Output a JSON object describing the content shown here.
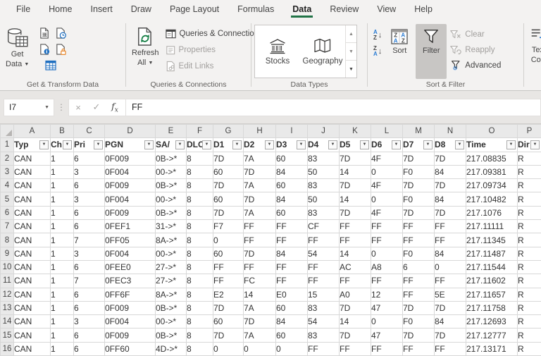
{
  "ribbon": {
    "tabs": [
      "File",
      "Home",
      "Insert",
      "Draw",
      "Page Layout",
      "Formulas",
      "Data",
      "Review",
      "View",
      "Help"
    ],
    "active_tab": "Data",
    "accent_green": "#217346",
    "groups": {
      "get_transform": {
        "label": "Get & Transform Data",
        "get_data_line1": "Get",
        "get_data_line2": "Data"
      },
      "queries": {
        "label": "Queries & Connections",
        "refresh_line1": "Refresh",
        "refresh_line2": "All",
        "items": [
          {
            "label": "Queries & Connections",
            "enabled": true
          },
          {
            "label": "Properties",
            "enabled": false
          },
          {
            "label": "Edit Links",
            "enabled": false
          }
        ]
      },
      "data_types": {
        "label": "Data Types",
        "items": [
          "Stocks",
          "Geography"
        ]
      },
      "sort_filter": {
        "label": "Sort & Filter",
        "sort": "Sort",
        "filter": "Filter",
        "clear": "Clear",
        "reapply": "Reapply",
        "advanced": "Advanced"
      },
      "text_columns": {
        "label_line1": "Text",
        "label_line2": "Colu"
      }
    }
  },
  "formula_bar": {
    "name_box": "I7",
    "formula": "FF"
  },
  "grid": {
    "column_letters": [
      "A",
      "B",
      "C",
      "D",
      "E",
      "F",
      "G",
      "H",
      "I",
      "J",
      "K",
      "L",
      "M",
      "N",
      "O",
      "P"
    ],
    "headers": [
      "Typ",
      "Ch",
      "Pri",
      "PGN",
      "SA/",
      "DLC",
      "D1",
      "D2",
      "D3",
      "D4",
      "D5",
      "D6",
      "D7",
      "D8",
      "Time",
      "Dir"
    ],
    "rows": [
      [
        "CAN",
        "1",
        "6",
        "0F009",
        "0B->*",
        "8",
        "7D",
        "7A",
        "60",
        "83",
        "7D",
        "4F",
        "7D",
        "7D",
        "217.08835",
        "R"
      ],
      [
        "CAN",
        "1",
        "3",
        "0F004",
        "00->*",
        "8",
        "60",
        "7D",
        "84",
        "50",
        "14",
        "0",
        "F0",
        "84",
        "217.09381",
        "R"
      ],
      [
        "CAN",
        "1",
        "6",
        "0F009",
        "0B->*",
        "8",
        "7D",
        "7A",
        "60",
        "83",
        "7D",
        "4F",
        "7D",
        "7D",
        "217.09734",
        "R"
      ],
      [
        "CAN",
        "1",
        "3",
        "0F004",
        "00->*",
        "8",
        "60",
        "7D",
        "84",
        "50",
        "14",
        "0",
        "F0",
        "84",
        "217.10482",
        "R"
      ],
      [
        "CAN",
        "1",
        "6",
        "0F009",
        "0B->*",
        "8",
        "7D",
        "7A",
        "60",
        "83",
        "7D",
        "4F",
        "7D",
        "7D",
        "217.1076",
        "R"
      ],
      [
        "CAN",
        "1",
        "6",
        "0FEF1",
        "31->*",
        "8",
        "F7",
        "FF",
        "FF",
        "CF",
        "FF",
        "FF",
        "FF",
        "FF",
        "217.11111",
        "R"
      ],
      [
        "CAN",
        "1",
        "7",
        "0FF05",
        "8A->*",
        "8",
        "0",
        "FF",
        "FF",
        "FF",
        "FF",
        "FF",
        "FF",
        "FF",
        "217.11345",
        "R"
      ],
      [
        "CAN",
        "1",
        "3",
        "0F004",
        "00->*",
        "8",
        "60",
        "7D",
        "84",
        "54",
        "14",
        "0",
        "F0",
        "84",
        "217.11487",
        "R"
      ],
      [
        "CAN",
        "1",
        "6",
        "0FEE0",
        "27->*",
        "8",
        "FF",
        "FF",
        "FF",
        "FF",
        "AC",
        "A8",
        "6",
        "0",
        "217.11544",
        "R"
      ],
      [
        "CAN",
        "1",
        "7",
        "0FEC3",
        "27->*",
        "8",
        "FF",
        "FC",
        "FF",
        "FF",
        "FF",
        "FF",
        "FF",
        "FF",
        "217.11602",
        "R"
      ],
      [
        "CAN",
        "1",
        "6",
        "0FF6F",
        "8A->*",
        "8",
        "E2",
        "14",
        "E0",
        "15",
        "A0",
        "12",
        "FF",
        "5E",
        "217.11657",
        "R"
      ],
      [
        "CAN",
        "1",
        "6",
        "0F009",
        "0B->*",
        "8",
        "7D",
        "7A",
        "60",
        "83",
        "7D",
        "47",
        "7D",
        "7D",
        "217.11758",
        "R"
      ],
      [
        "CAN",
        "1",
        "3",
        "0F004",
        "00->*",
        "8",
        "60",
        "7D",
        "84",
        "54",
        "14",
        "0",
        "F0",
        "84",
        "217.12693",
        "R"
      ],
      [
        "CAN",
        "1",
        "6",
        "0F009",
        "0B->*",
        "8",
        "7D",
        "7A",
        "60",
        "83",
        "7D",
        "47",
        "7D",
        "7D",
        "217.12777",
        "R"
      ],
      [
        "CAN",
        "1",
        "6",
        "0FF60",
        "4D->*",
        "8",
        "0",
        "0",
        "0",
        "FF",
        "FF",
        "FF",
        "FF",
        "FF",
        "217.13171",
        "R"
      ]
    ]
  }
}
